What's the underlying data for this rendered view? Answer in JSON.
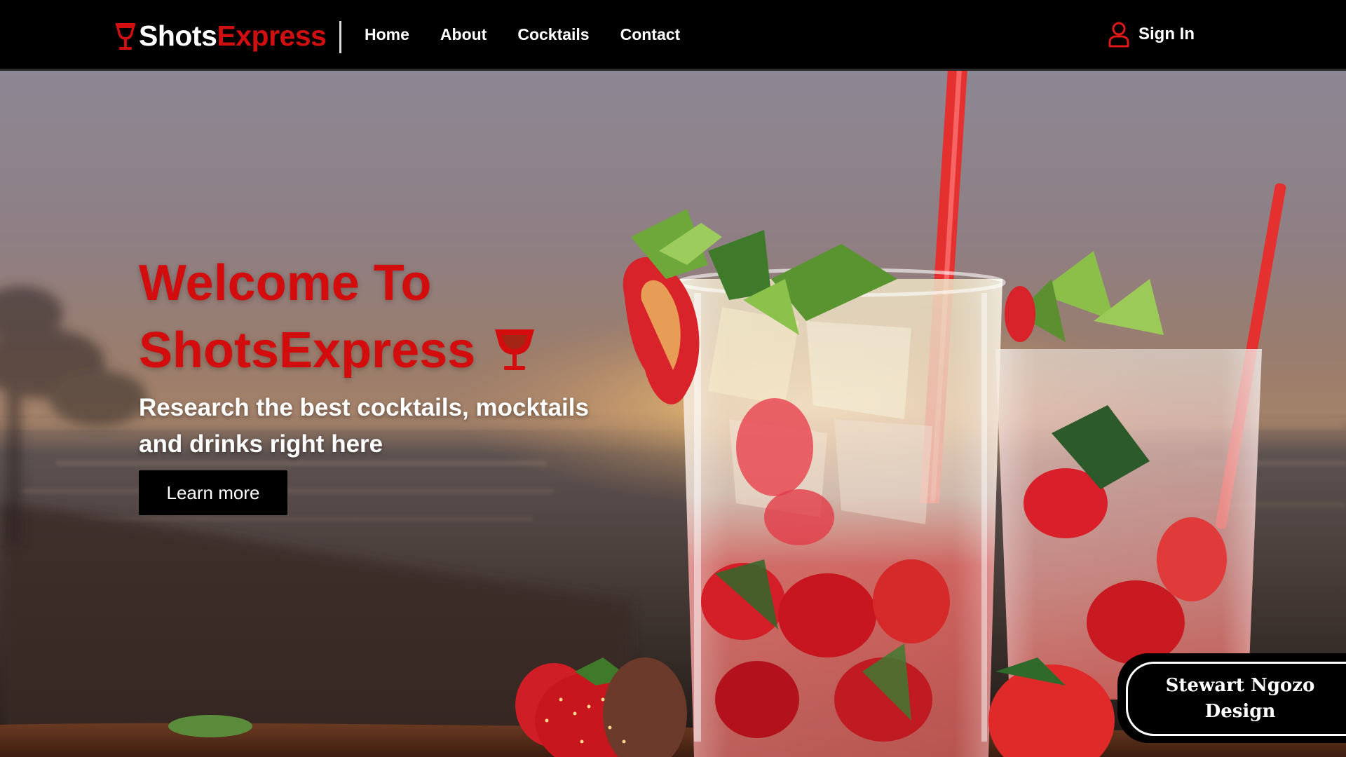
{
  "brand": {
    "name_part1": "Shots",
    "name_part2": "Express",
    "icon": "wine-glass-icon",
    "accent_color": "#d01010"
  },
  "nav": {
    "links": [
      "Home",
      "About",
      "Cocktails",
      "Contact"
    ],
    "signin_label": "Sign In",
    "signin_icon": "user-icon"
  },
  "hero": {
    "title_line1": "Welcome To",
    "title_line2": "ShotsExpress",
    "title_icon": "wine-glass-icon",
    "subtitle": "Research the best cocktails, mocktails and drinks right here",
    "cta_label": "Learn more"
  },
  "badge": {
    "text": "Stewart Ngozo Design"
  }
}
